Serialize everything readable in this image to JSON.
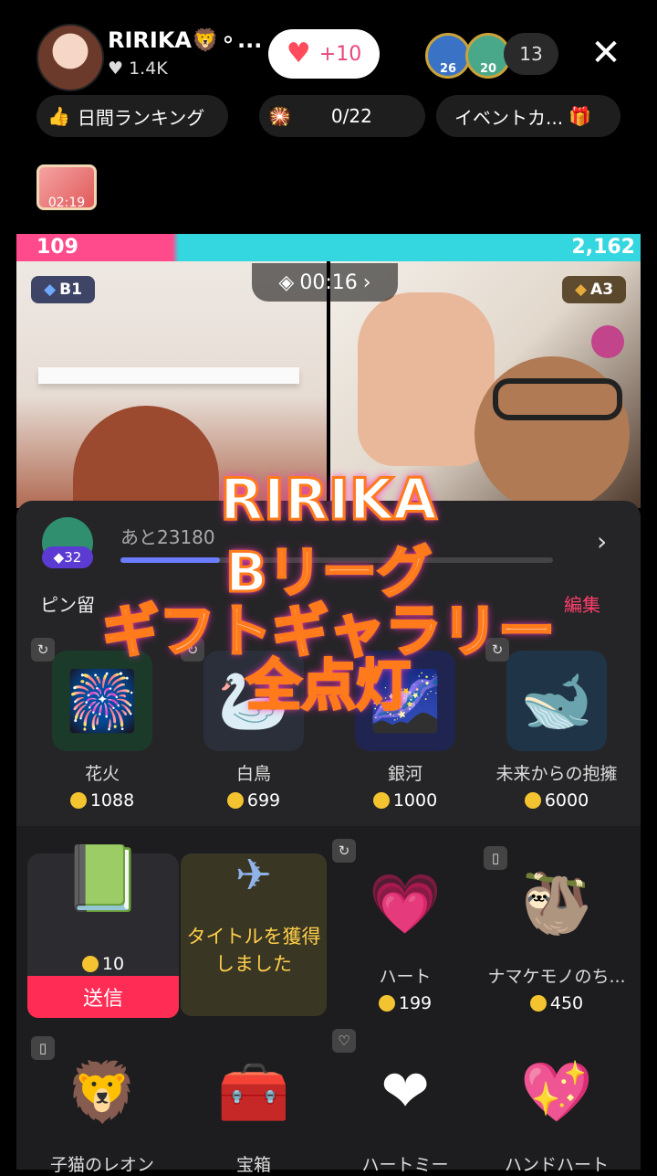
{
  "header": {
    "host_name": "RIRIKA🦁⚬...",
    "host_likes": "1.4K",
    "follow_label": "+10",
    "viewer_badges": [
      "26",
      "20"
    ],
    "viewer_count": "13",
    "close_icon": "close-icon"
  },
  "pills": {
    "ranking": "日間ランキング",
    "goal": "0/22",
    "event": "イベントカ..."
  },
  "chest_timer": "02:19",
  "battle": {
    "left_score": "109",
    "right_score": "2,162",
    "left_league": "B1",
    "right_league": "A3",
    "timer": "00:16"
  },
  "level": {
    "badge": "32",
    "progress_text": "あと23180",
    "progress": 0.23
  },
  "pinned_label": "ピン留",
  "edit_label": "編集",
  "gifts_row1": [
    {
      "name": "花火",
      "price": "1088",
      "icon": "🎆",
      "bg": "#1b3a2a"
    },
    {
      "name": "白鳥",
      "price": "699",
      "icon": "🦢",
      "bg": "#2a2f3a"
    },
    {
      "name": "銀河",
      "price": "1000",
      "icon": "🌌",
      "bg": "#1f2550"
    },
    {
      "name": "未来からの抱擁",
      "price": "6000",
      "icon": "🐋",
      "bg": "#1f3446"
    }
  ],
  "selected_gift": {
    "price": "10",
    "send_label": "送信",
    "icon": "📗"
  },
  "title_card": {
    "text": "タイトルを獲得しました",
    "icon": "✈"
  },
  "gifts_row2": [
    {
      "name": "ハート",
      "price": "199",
      "icon": "💗"
    },
    {
      "name": "ナマケモノのち...",
      "price": "450",
      "icon": "🦥"
    }
  ],
  "gifts_row3": [
    {
      "name": "子猫のレオン",
      "icon": "🦁"
    },
    {
      "name": "宝箱",
      "icon": "🧰"
    },
    {
      "name": "ハートミー",
      "icon": "❤"
    },
    {
      "name": "ハンドハート",
      "icon": "💖"
    }
  ],
  "caption": {
    "line1": "RIRIKA",
    "line2": "Bリーグ",
    "line3": "ギフトギャラリー",
    "line4": "全点灯"
  },
  "colors": {
    "accent": "#ff2d55",
    "pink_bar": "#ff4b8b",
    "cyan_bar": "#34d7e0",
    "coin": "#f4c430"
  }
}
